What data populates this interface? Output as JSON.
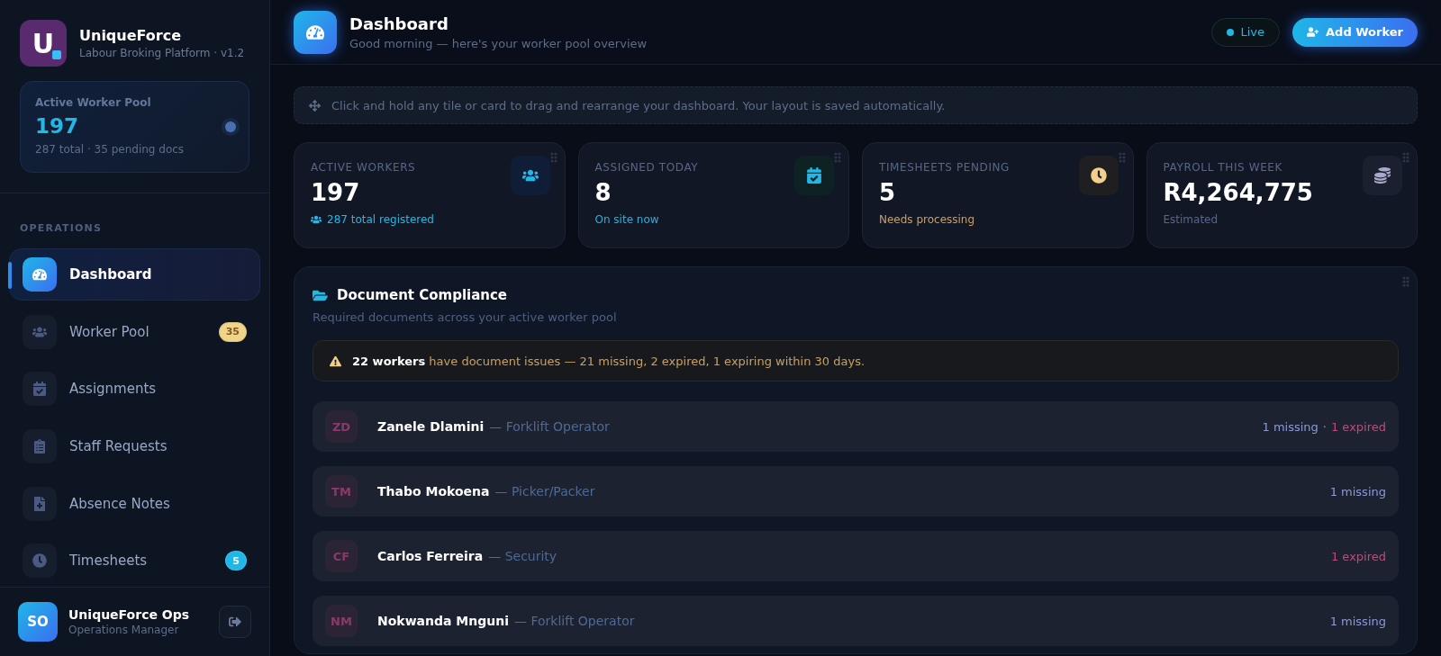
{
  "brand": {
    "logo_letter": "U",
    "name": "UniqueForce",
    "subtitle": "Labour Broking Platform · v1.2"
  },
  "pool_card": {
    "label": "Active Worker Pool",
    "value": "197",
    "detail": "287 total · 35 pending docs"
  },
  "sidebar": {
    "section": "OPERATIONS",
    "items": [
      {
        "label": "Dashboard",
        "selected": true
      },
      {
        "label": "Worker Pool",
        "selected": false,
        "badge": "35",
        "color": "#f2d38a"
      },
      {
        "label": "Assignments",
        "selected": false
      },
      {
        "label": "Staff Requests",
        "selected": false
      },
      {
        "label": "Absence Notes",
        "selected": false
      },
      {
        "label": "Timesheets",
        "selected": false,
        "badge": "5",
        "color": "#1fb6e8"
      }
    ]
  },
  "user": {
    "initials": "SO",
    "name": "UniqueForce Ops",
    "role": "Operations Manager"
  },
  "header": {
    "title": "Dashboard",
    "subtitle": "Good morning — here's your worker pool overview",
    "live": "Live",
    "add_button": "Add Worker"
  },
  "hint": "Click and hold any tile or card to drag and rearrange your dashboard. Your layout is saved automatically.",
  "stats": [
    {
      "label": "ACTIVE WORKERS",
      "value": "197",
      "note": "287 total registered",
      "color": "#22b8e6"
    },
    {
      "label": "ASSIGNED TODAY",
      "value": "8",
      "note": "On site now",
      "color": "#2ab0dc"
    },
    {
      "label": "TIMESHEETS PENDING",
      "value": "5",
      "note": "Needs processing",
      "color": "#c8a062"
    },
    {
      "label": "PAYROLL THIS WEEK",
      "value": "R4,264,775",
      "note": "Estimated",
      "color": "#56688a"
    }
  ],
  "compliance": {
    "title": "Document Compliance",
    "subtitle": "Required documents across your active worker pool",
    "alert": "**22 workers** have document issues — 21 missing, 2 expired, 1 expiring within 30 days.",
    "separator": "·",
    "rows": [
      {
        "initials": "ZD",
        "name": "Zanele Dlamini",
        "role": "— Forklift Operator",
        "issues": [
          {
            "text": "1 missing",
            "kind": "missing"
          },
          {
            "text": "1 expired",
            "kind": "expired"
          }
        ]
      },
      {
        "initials": "TM",
        "name": "Thabo Mokoena",
        "role": "— Picker/Packer",
        "issues": [
          {
            "text": "1 missing",
            "kind": "missing"
          }
        ]
      },
      {
        "initials": "CF",
        "name": "Carlos Ferreira",
        "role": "— Security",
        "issues": [
          {
            "text": "1 expired",
            "kind": "expired"
          }
        ]
      },
      {
        "initials": "NM",
        "name": "Nokwanda Mnguni",
        "role": "— Forklift Operator",
        "issues": [
          {
            "text": "1 missing",
            "kind": "missing"
          }
        ]
      }
    ]
  }
}
